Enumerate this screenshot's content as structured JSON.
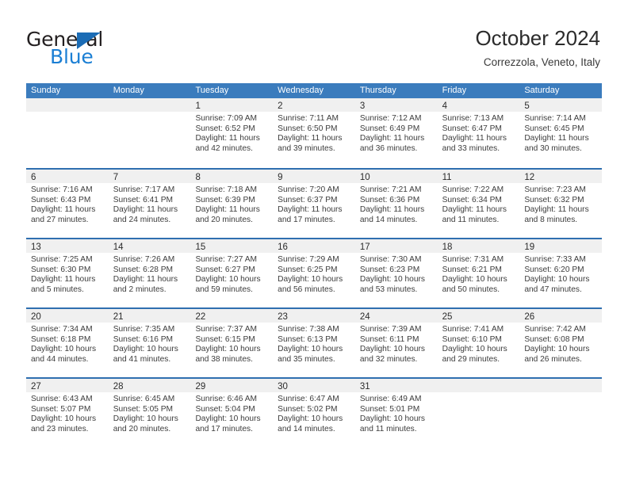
{
  "brand": {
    "name_top": "General",
    "name_bottom": "Blue",
    "triangle_icon": "triangle-icon",
    "color_dark": "#231f20",
    "color_blue": "#1b7fd4"
  },
  "header": {
    "title": "October 2024",
    "subtitle": "Correzzola, Veneto, Italy"
  },
  "calendar": {
    "accent_color": "#3b7cbd",
    "band_color": "#f0f0f0",
    "weekdays": [
      "Sunday",
      "Monday",
      "Tuesday",
      "Wednesday",
      "Thursday",
      "Friday",
      "Saturday"
    ],
    "weeks": [
      [
        {
          "day": "",
          "lines": []
        },
        {
          "day": "",
          "lines": []
        },
        {
          "day": "1",
          "lines": [
            "Sunrise: 7:09 AM",
            "Sunset: 6:52 PM",
            "Daylight: 11 hours",
            "and 42 minutes."
          ]
        },
        {
          "day": "2",
          "lines": [
            "Sunrise: 7:11 AM",
            "Sunset: 6:50 PM",
            "Daylight: 11 hours",
            "and 39 minutes."
          ]
        },
        {
          "day": "3",
          "lines": [
            "Sunrise: 7:12 AM",
            "Sunset: 6:49 PM",
            "Daylight: 11 hours",
            "and 36 minutes."
          ]
        },
        {
          "day": "4",
          "lines": [
            "Sunrise: 7:13 AM",
            "Sunset: 6:47 PM",
            "Daylight: 11 hours",
            "and 33 minutes."
          ]
        },
        {
          "day": "5",
          "lines": [
            "Sunrise: 7:14 AM",
            "Sunset: 6:45 PM",
            "Daylight: 11 hours",
            "and 30 minutes."
          ]
        }
      ],
      [
        {
          "day": "6",
          "lines": [
            "Sunrise: 7:16 AM",
            "Sunset: 6:43 PM",
            "Daylight: 11 hours",
            "and 27 minutes."
          ]
        },
        {
          "day": "7",
          "lines": [
            "Sunrise: 7:17 AM",
            "Sunset: 6:41 PM",
            "Daylight: 11 hours",
            "and 24 minutes."
          ]
        },
        {
          "day": "8",
          "lines": [
            "Sunrise: 7:18 AM",
            "Sunset: 6:39 PM",
            "Daylight: 11 hours",
            "and 20 minutes."
          ]
        },
        {
          "day": "9",
          "lines": [
            "Sunrise: 7:20 AM",
            "Sunset: 6:37 PM",
            "Daylight: 11 hours",
            "and 17 minutes."
          ]
        },
        {
          "day": "10",
          "lines": [
            "Sunrise: 7:21 AM",
            "Sunset: 6:36 PM",
            "Daylight: 11 hours",
            "and 14 minutes."
          ]
        },
        {
          "day": "11",
          "lines": [
            "Sunrise: 7:22 AM",
            "Sunset: 6:34 PM",
            "Daylight: 11 hours",
            "and 11 minutes."
          ]
        },
        {
          "day": "12",
          "lines": [
            "Sunrise: 7:23 AM",
            "Sunset: 6:32 PM",
            "Daylight: 11 hours",
            "and 8 minutes."
          ]
        }
      ],
      [
        {
          "day": "13",
          "lines": [
            "Sunrise: 7:25 AM",
            "Sunset: 6:30 PM",
            "Daylight: 11 hours",
            "and 5 minutes."
          ]
        },
        {
          "day": "14",
          "lines": [
            "Sunrise: 7:26 AM",
            "Sunset: 6:28 PM",
            "Daylight: 11 hours",
            "and 2 minutes."
          ]
        },
        {
          "day": "15",
          "lines": [
            "Sunrise: 7:27 AM",
            "Sunset: 6:27 PM",
            "Daylight: 10 hours",
            "and 59 minutes."
          ]
        },
        {
          "day": "16",
          "lines": [
            "Sunrise: 7:29 AM",
            "Sunset: 6:25 PM",
            "Daylight: 10 hours",
            "and 56 minutes."
          ]
        },
        {
          "day": "17",
          "lines": [
            "Sunrise: 7:30 AM",
            "Sunset: 6:23 PM",
            "Daylight: 10 hours",
            "and 53 minutes."
          ]
        },
        {
          "day": "18",
          "lines": [
            "Sunrise: 7:31 AM",
            "Sunset: 6:21 PM",
            "Daylight: 10 hours",
            "and 50 minutes."
          ]
        },
        {
          "day": "19",
          "lines": [
            "Sunrise: 7:33 AM",
            "Sunset: 6:20 PM",
            "Daylight: 10 hours",
            "and 47 minutes."
          ]
        }
      ],
      [
        {
          "day": "20",
          "lines": [
            "Sunrise: 7:34 AM",
            "Sunset: 6:18 PM",
            "Daylight: 10 hours",
            "and 44 minutes."
          ]
        },
        {
          "day": "21",
          "lines": [
            "Sunrise: 7:35 AM",
            "Sunset: 6:16 PM",
            "Daylight: 10 hours",
            "and 41 minutes."
          ]
        },
        {
          "day": "22",
          "lines": [
            "Sunrise: 7:37 AM",
            "Sunset: 6:15 PM",
            "Daylight: 10 hours",
            "and 38 minutes."
          ]
        },
        {
          "day": "23",
          "lines": [
            "Sunrise: 7:38 AM",
            "Sunset: 6:13 PM",
            "Daylight: 10 hours",
            "and 35 minutes."
          ]
        },
        {
          "day": "24",
          "lines": [
            "Sunrise: 7:39 AM",
            "Sunset: 6:11 PM",
            "Daylight: 10 hours",
            "and 32 minutes."
          ]
        },
        {
          "day": "25",
          "lines": [
            "Sunrise: 7:41 AM",
            "Sunset: 6:10 PM",
            "Daylight: 10 hours",
            "and 29 minutes."
          ]
        },
        {
          "day": "26",
          "lines": [
            "Sunrise: 7:42 AM",
            "Sunset: 6:08 PM",
            "Daylight: 10 hours",
            "and 26 minutes."
          ]
        }
      ],
      [
        {
          "day": "27",
          "lines": [
            "Sunrise: 6:43 AM",
            "Sunset: 5:07 PM",
            "Daylight: 10 hours",
            "and 23 minutes."
          ]
        },
        {
          "day": "28",
          "lines": [
            "Sunrise: 6:45 AM",
            "Sunset: 5:05 PM",
            "Daylight: 10 hours",
            "and 20 minutes."
          ]
        },
        {
          "day": "29",
          "lines": [
            "Sunrise: 6:46 AM",
            "Sunset: 5:04 PM",
            "Daylight: 10 hours",
            "and 17 minutes."
          ]
        },
        {
          "day": "30",
          "lines": [
            "Sunrise: 6:47 AM",
            "Sunset: 5:02 PM",
            "Daylight: 10 hours",
            "and 14 minutes."
          ]
        },
        {
          "day": "31",
          "lines": [
            "Sunrise: 6:49 AM",
            "Sunset: 5:01 PM",
            "Daylight: 10 hours",
            "and 11 minutes."
          ]
        },
        {
          "day": "",
          "lines": []
        },
        {
          "day": "",
          "lines": []
        }
      ]
    ]
  }
}
